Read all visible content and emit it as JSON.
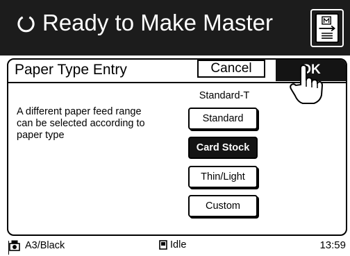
{
  "header": {
    "title": "Ready to Make Master",
    "refresh_icon": "refresh-icon",
    "master_icon": "master-print-icon"
  },
  "dialog": {
    "title": "Paper Type Entry",
    "cancel_label": "Cancel",
    "ok_label": "OK",
    "description": "A different paper feed range can be selected according to paper type",
    "current_value": "Standard-T",
    "options": [
      {
        "label": "Standard",
        "selected": false
      },
      {
        "label": "Card Stock",
        "selected": true
      },
      {
        "label": "Thin/Light",
        "selected": false
      },
      {
        "label": "Custom",
        "selected": false
      }
    ]
  },
  "status": {
    "paper_ink": "A3/Black",
    "state": "Idle",
    "time": "13:59"
  },
  "colors": {
    "header_bg": "#1c1c1c",
    "selected_bg": "#141414"
  }
}
